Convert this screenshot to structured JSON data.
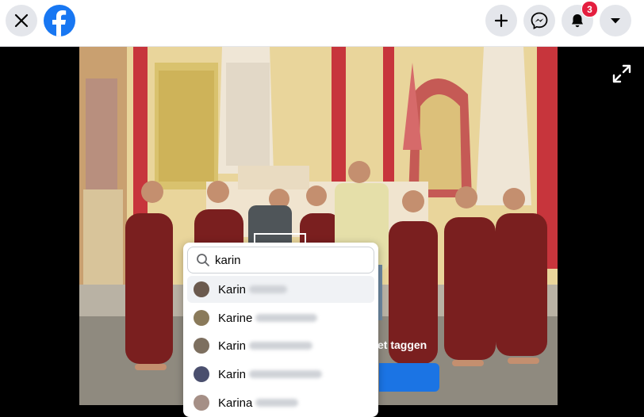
{
  "header": {
    "close_icon": "close-icon",
    "logo": "facebook-logo",
    "create_icon": "plus-icon",
    "messenger_icon": "messenger-icon",
    "notifications_icon": "bell-icon",
    "notifications_count": "3",
    "account_icon": "caret-down-icon"
  },
  "viewer": {
    "expand_icon": "expand-icon",
    "background_label": "et taggen"
  },
  "tag_search": {
    "value": "karin",
    "search_icon": "search-icon",
    "suggestions": [
      {
        "name": "Karin",
        "avatar_color": "#6b5a4e"
      },
      {
        "name": "Karine",
        "avatar_color": "#8a7a5a"
      },
      {
        "name": "Karin",
        "avatar_color": "#7d6f5f"
      },
      {
        "name": "Karin",
        "avatar_color": "#4a4f6e"
      },
      {
        "name": "Karina",
        "avatar_color": "#a58f86"
      }
    ]
  },
  "colors": {
    "brand": "#1877f2",
    "badge": "#e41e3f",
    "button_bg": "#e4e6eb"
  }
}
